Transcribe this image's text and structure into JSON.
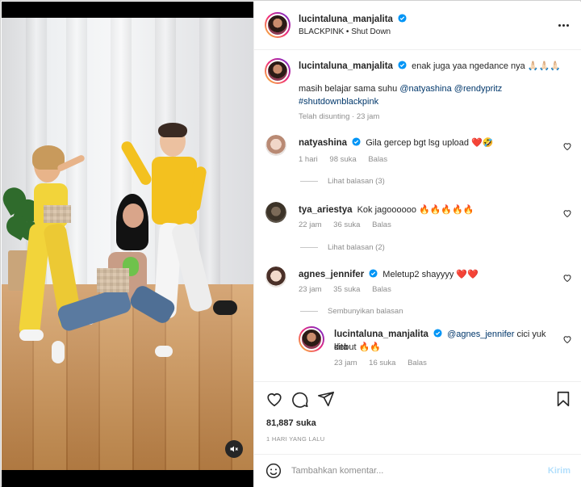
{
  "post": {
    "author": "lucintaluna_manjalita",
    "audio": "BLACKPINK • Shut Down",
    "caption": {
      "author": "lucintaluna_manjalita",
      "text_line1": "enak juga yaa ngedance nya 🙏🏻🙏🏻🙏🏻",
      "text_line2_prefix": "masih belajar sama suhu",
      "mention1": "@natyashina",
      "mention2": "@rendypritz",
      "hashtag": "#shutdownblackpink",
      "edited": "Telah disunting · 23 jam"
    },
    "likes": "81,887 suka",
    "date": "1 HARI YANG LALU"
  },
  "comments": [
    {
      "user": "natyashina",
      "text": "Gila gercep bgt lsg upload ❤️🤣",
      "time": "1 hari",
      "likes": "98 suka",
      "reply_label": "Balas",
      "replies_toggle": "Lihat balasan (3)"
    },
    {
      "user": "tya_ariestya",
      "text": "Kok jagoooooo 🔥🔥🔥🔥🔥",
      "time": "22 jam",
      "likes": "36 suka",
      "reply_label": "Balas",
      "replies_toggle": "Lihat balasan (2)"
    },
    {
      "user": "agnes_jennifer",
      "text": "Meletup2 shayyyy ❤️❤️",
      "time": "23 jam",
      "likes": "35 suka",
      "reply_label": "Balas",
      "replies_toggle": "Sembunyikan balasan",
      "reply": {
        "user": "lucintaluna_manjalita",
        "mention": "@agnes_jennifer",
        "text_line1": "cici yuk kita",
        "text_line2": "debut 🔥🔥",
        "time": "23 jam",
        "likes": "16 suka",
        "reply_label": "Balas"
      }
    }
  ],
  "comment_box": {
    "placeholder": "Tambahkan komentar...",
    "send_label": "Kirim"
  },
  "icons": {
    "verified": "verified-badge-icon",
    "like": "heart-icon",
    "comment": "comment-icon",
    "share": "send-icon",
    "save": "bookmark-icon",
    "mute": "speaker-muted-icon",
    "emoji": "emoji-icon",
    "more": "more-options-icon"
  },
  "colors": {
    "verified_blue": "#0095f6",
    "link": "#00376b",
    "muted_text": "#8e8e8e",
    "send_disabled": "#b2dffc"
  }
}
